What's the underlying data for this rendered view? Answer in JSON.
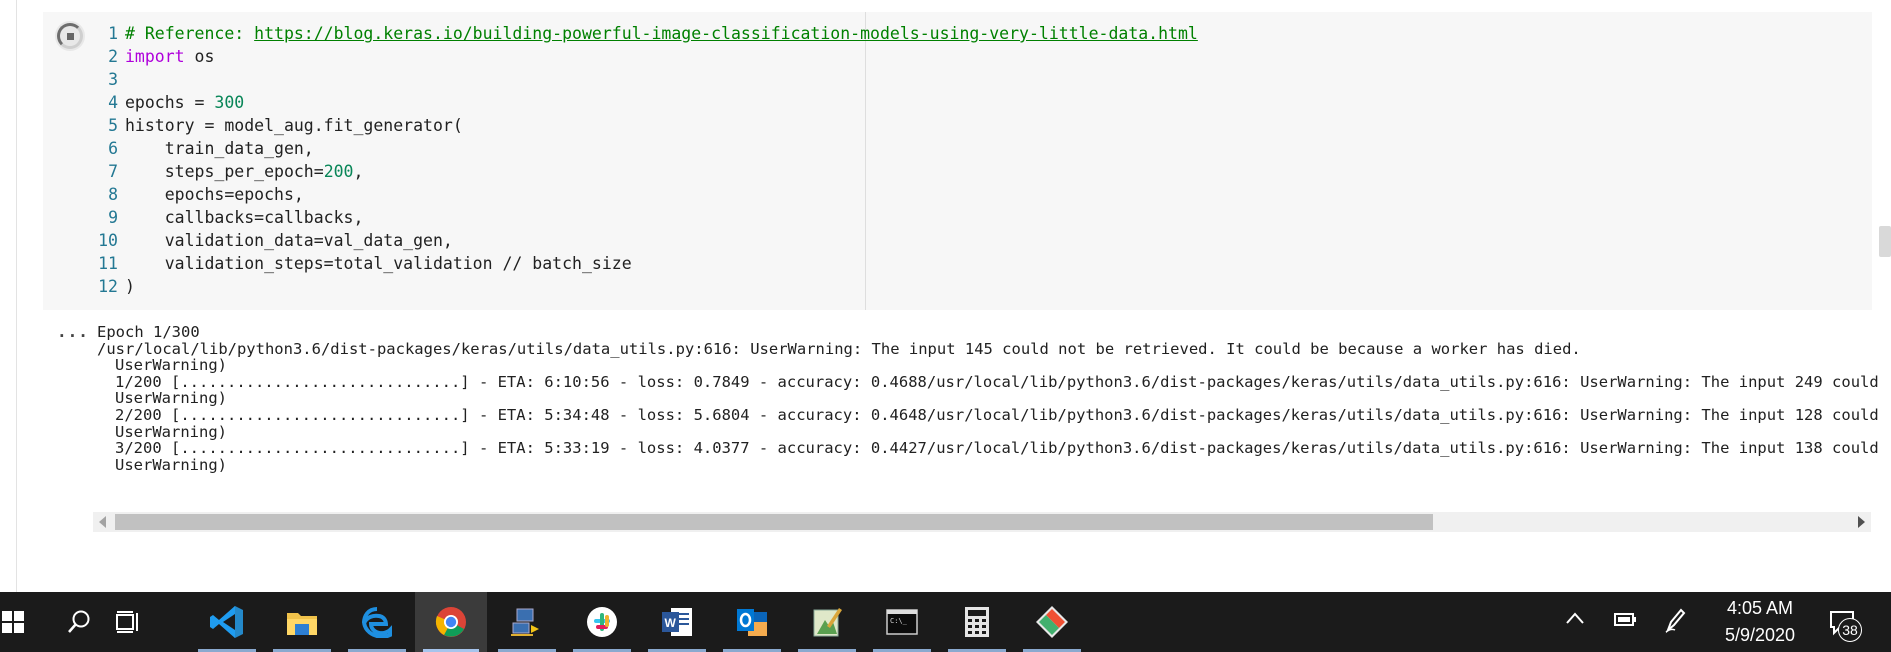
{
  "code_cell": {
    "lines": [
      {
        "n": "1",
        "comment": "# Reference: ",
        "link": "https://blog.keras.io/building-powerful-image-classification-models-using-very-little-data.html"
      },
      {
        "n": "2",
        "kw": "import",
        "rest": " os"
      },
      {
        "n": "3",
        "text": ""
      },
      {
        "n": "4",
        "pre": "epochs = ",
        "num": "300"
      },
      {
        "n": "5",
        "text": "history = model_aug.fit_generator("
      },
      {
        "n": "6",
        "text": "    train_data_gen,"
      },
      {
        "n": "7",
        "pre": "    steps_per_epoch=",
        "num": "200",
        "post": ","
      },
      {
        "n": "8",
        "text": "    epochs=epochs,"
      },
      {
        "n": "9",
        "text": "    callbacks=callbacks,"
      },
      {
        "n": "10",
        "text": "    validation_data=val_data_gen,"
      },
      {
        "n": "11",
        "text": "    validation_steps=total_validation // batch_size"
      },
      {
        "n": "12",
        "text": ")"
      }
    ]
  },
  "output": {
    "menu_label": "...",
    "lines": [
      "Epoch 1/300",
      "/usr/local/lib/python3.6/dist-packages/keras/utils/data_utils.py:616: UserWarning: The input 145 could not be retrieved. It could be because a worker has died.",
      "UserWarning)",
      "1/200 [..............................] - ETA: 6:10:56 - loss: 0.7849 - accuracy: 0.4688/usr/local/lib/python3.6/dist-packages/keras/utils/data_utils.py:616: UserWarning: The input 249 could",
      "UserWarning)",
      "2/200 [..............................] - ETA: 5:34:48 - loss: 5.6804 - accuracy: 0.4648/usr/local/lib/python3.6/dist-packages/keras/utils/data_utils.py:616: UserWarning: The input 128 could",
      "UserWarning)",
      "3/200 [..............................] - ETA: 5:33:19 - loss: 4.0377 - accuracy: 0.4427/usr/local/lib/python3.6/dist-packages/keras/utils/data_utils.py:616: UserWarning: The input 138 could",
      "UserWarning)"
    ],
    "scroll_fraction": 0.76
  },
  "taskbar": {
    "apps": [
      {
        "icon": "windows-start-icon"
      },
      {
        "icon": "search-icon"
      },
      {
        "icon": "task-view-icon"
      },
      {
        "icon": "vscode-icon",
        "open": true
      },
      {
        "icon": "file-explorer-icon",
        "open": true
      },
      {
        "icon": "edge-icon",
        "open": true
      },
      {
        "icon": "chrome-icon",
        "open": true,
        "active": true
      },
      {
        "icon": "remote-desktop-icon",
        "open": true
      },
      {
        "icon": "slack-icon",
        "open": true
      },
      {
        "icon": "word-icon",
        "open": true
      },
      {
        "icon": "outlook-icon",
        "open": true
      },
      {
        "icon": "notepad-icon",
        "open": true
      },
      {
        "icon": "terminal-icon",
        "open": true
      },
      {
        "icon": "calculator-icon",
        "open": true
      },
      {
        "icon": "git-icon",
        "open": true
      }
    ],
    "clock": {
      "time": "4:05 AM",
      "date": "5/9/2020"
    },
    "notification_count": "38",
    "tray": [
      "chevron-up-icon",
      "battery-icon",
      "pen-icon"
    ]
  }
}
